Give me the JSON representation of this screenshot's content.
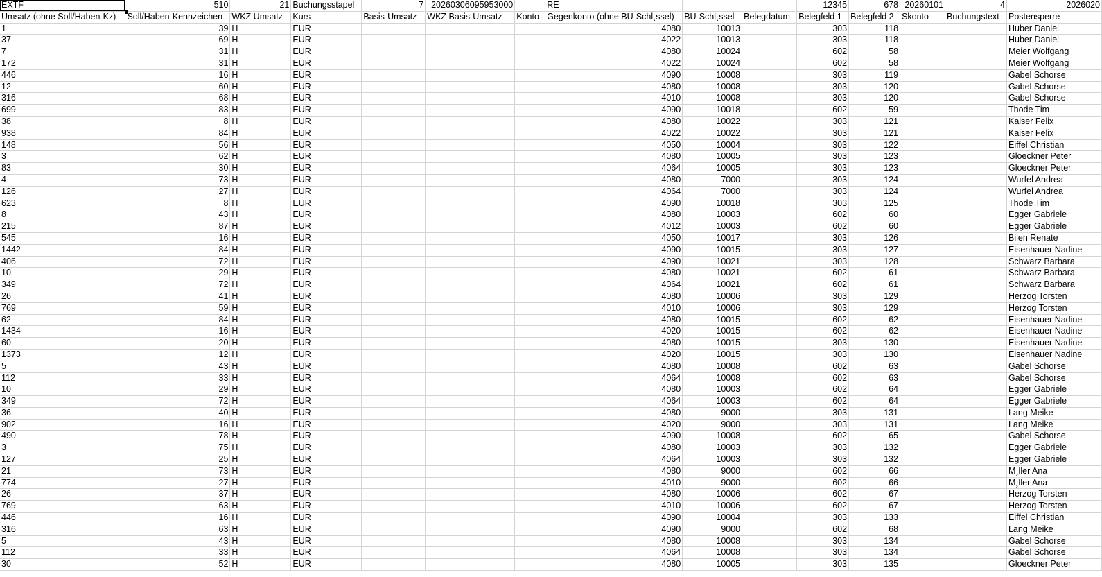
{
  "sheet": {
    "columns": [
      {
        "align": "txt"
      },
      {
        "align": "num"
      },
      {
        "align": "txt"
      },
      {
        "align": "txt"
      },
      {
        "align": "txt"
      },
      {
        "align": "txt"
      },
      {
        "align": "txt"
      },
      {
        "align": "num"
      },
      {
        "align": "num"
      },
      {
        "align": "txt"
      },
      {
        "align": "num"
      },
      {
        "align": "num"
      },
      {
        "align": "txt"
      },
      {
        "align": "txt"
      },
      {
        "align": "txt"
      }
    ],
    "meta_row": [
      "EXTF",
      "510",
      "21",
      "Buchungsstapel",
      "7",
      "20260306095953000",
      "",
      "RE",
      "",
      "",
      "12345",
      "678",
      "20260101",
      "4",
      "2026020"
    ],
    "meta_align": [
      "txt",
      "num",
      "num",
      "txt",
      "num",
      "num",
      "txt",
      "txt",
      "txt",
      "txt",
      "num",
      "num",
      "num",
      "num",
      "num"
    ],
    "header_row": [
      "Umsatz (ohne Soll/Haben-Kz)",
      "Soll/Haben-Kennzeichen",
      "WKZ Umsatz",
      "Kurs",
      "Basis-Umsatz",
      "WKZ Basis-Umsatz",
      "Konto",
      "Gegenkonto (ohne BU-Schl¸ssel)",
      "BU-Schl¸ssel",
      "Belegdatum",
      "Belegfeld 1",
      "Belegfeld 2",
      "Skonto",
      "Buchungstext",
      "Postensperre"
    ],
    "rows": [
      [
        "1",
        "39",
        "H",
        "EUR",
        "",
        "",
        "",
        "4080",
        "10013",
        "",
        "303",
        "118",
        "",
        "",
        "Huber Daniel"
      ],
      [
        "37",
        "69",
        "H",
        "EUR",
        "",
        "",
        "",
        "4022",
        "10013",
        "",
        "303",
        "118",
        "",
        "",
        "Huber Daniel"
      ],
      [
        "7",
        "31",
        "H",
        "EUR",
        "",
        "",
        "",
        "4080",
        "10024",
        "",
        "602",
        "58",
        "",
        "",
        "Meier Wolfgang"
      ],
      [
        "172",
        "31",
        "H",
        "EUR",
        "",
        "",
        "",
        "4022",
        "10024",
        "",
        "602",
        "58",
        "",
        "",
        "Meier Wolfgang"
      ],
      [
        "446",
        "16",
        "H",
        "EUR",
        "",
        "",
        "",
        "4090",
        "10008",
        "",
        "303",
        "119",
        "",
        "",
        "Gabel Schorse"
      ],
      [
        "12",
        "60",
        "H",
        "EUR",
        "",
        "",
        "",
        "4080",
        "10008",
        "",
        "303",
        "120",
        "",
        "",
        "Gabel Schorse"
      ],
      [
        "316",
        "68",
        "H",
        "EUR",
        "",
        "",
        "",
        "4010",
        "10008",
        "",
        "303",
        "120",
        "",
        "",
        "Gabel Schorse"
      ],
      [
        "699",
        "83",
        "H",
        "EUR",
        "",
        "",
        "",
        "4090",
        "10018",
        "",
        "602",
        "59",
        "",
        "",
        "Thode Tim"
      ],
      [
        "38",
        "8",
        "H",
        "EUR",
        "",
        "",
        "",
        "4080",
        "10022",
        "",
        "303",
        "121",
        "",
        "",
        "Kaiser Felix"
      ],
      [
        "938",
        "84",
        "H",
        "EUR",
        "",
        "",
        "",
        "4022",
        "10022",
        "",
        "303",
        "121",
        "",
        "",
        "Kaiser Felix"
      ],
      [
        "148",
        "56",
        "H",
        "EUR",
        "",
        "",
        "",
        "4050",
        "10004",
        "",
        "303",
        "122",
        "",
        "",
        "Eiffel Christian"
      ],
      [
        "3",
        "62",
        "H",
        "EUR",
        "",
        "",
        "",
        "4080",
        "10005",
        "",
        "303",
        "123",
        "",
        "",
        "Gloeckner Peter"
      ],
      [
        "83",
        "30",
        "H",
        "EUR",
        "",
        "",
        "",
        "4064",
        "10005",
        "",
        "303",
        "123",
        "",
        "",
        "Gloeckner Peter"
      ],
      [
        "4",
        "73",
        "H",
        "EUR",
        "",
        "",
        "",
        "4080",
        "7000",
        "",
        "303",
        "124",
        "",
        "",
        "Wurfel Andrea"
      ],
      [
        "126",
        "27",
        "H",
        "EUR",
        "",
        "",
        "",
        "4064",
        "7000",
        "",
        "303",
        "124",
        "",
        "",
        "Wurfel Andrea"
      ],
      [
        "623",
        "8",
        "H",
        "EUR",
        "",
        "",
        "",
        "4090",
        "10018",
        "",
        "303",
        "125",
        "",
        "",
        "Thode Tim"
      ],
      [
        "8",
        "43",
        "H",
        "EUR",
        "",
        "",
        "",
        "4080",
        "10003",
        "",
        "602",
        "60",
        "",
        "",
        "Egger Gabriele"
      ],
      [
        "215",
        "87",
        "H",
        "EUR",
        "",
        "",
        "",
        "4012",
        "10003",
        "",
        "602",
        "60",
        "",
        "",
        "Egger Gabriele"
      ],
      [
        "545",
        "16",
        "H",
        "EUR",
        "",
        "",
        "",
        "4050",
        "10017",
        "",
        "303",
        "126",
        "",
        "",
        "Bilen Renate"
      ],
      [
        "1442",
        "84",
        "H",
        "EUR",
        "",
        "",
        "",
        "4090",
        "10015",
        "",
        "303",
        "127",
        "",
        "",
        "Eisenhauer Nadine"
      ],
      [
        "406",
        "72",
        "H",
        "EUR",
        "",
        "",
        "",
        "4090",
        "10021",
        "",
        "303",
        "128",
        "",
        "",
        "Schwarz Barbara"
      ],
      [
        "10",
        "29",
        "H",
        "EUR",
        "",
        "",
        "",
        "4080",
        "10021",
        "",
        "602",
        "61",
        "",
        "",
        "Schwarz Barbara"
      ],
      [
        "349",
        "72",
        "H",
        "EUR",
        "",
        "",
        "",
        "4064",
        "10021",
        "",
        "602",
        "61",
        "",
        "",
        "Schwarz Barbara"
      ],
      [
        "26",
        "41",
        "H",
        "EUR",
        "",
        "",
        "",
        "4080",
        "10006",
        "",
        "303",
        "129",
        "",
        "",
        "Herzog Torsten"
      ],
      [
        "769",
        "59",
        "H",
        "EUR",
        "",
        "",
        "",
        "4010",
        "10006",
        "",
        "303",
        "129",
        "",
        "",
        "Herzog Torsten"
      ],
      [
        "62",
        "84",
        "H",
        "EUR",
        "",
        "",
        "",
        "4080",
        "10015",
        "",
        "602",
        "62",
        "",
        "",
        "Eisenhauer Nadine"
      ],
      [
        "1434",
        "16",
        "H",
        "EUR",
        "",
        "",
        "",
        "4020",
        "10015",
        "",
        "602",
        "62",
        "",
        "",
        "Eisenhauer Nadine"
      ],
      [
        "60",
        "20",
        "H",
        "EUR",
        "",
        "",
        "",
        "4080",
        "10015",
        "",
        "303",
        "130",
        "",
        "",
        "Eisenhauer Nadine"
      ],
      [
        "1373",
        "12",
        "H",
        "EUR",
        "",
        "",
        "",
        "4020",
        "10015",
        "",
        "303",
        "130",
        "",
        "",
        "Eisenhauer Nadine"
      ],
      [
        "5",
        "43",
        "H",
        "EUR",
        "",
        "",
        "",
        "4080",
        "10008",
        "",
        "602",
        "63",
        "",
        "",
        "Gabel Schorse"
      ],
      [
        "112",
        "33",
        "H",
        "EUR",
        "",
        "",
        "",
        "4064",
        "10008",
        "",
        "602",
        "63",
        "",
        "",
        "Gabel Schorse"
      ],
      [
        "10",
        "29",
        "H",
        "EUR",
        "",
        "",
        "",
        "4080",
        "10003",
        "",
        "602",
        "64",
        "",
        "",
        "Egger Gabriele"
      ],
      [
        "349",
        "72",
        "H",
        "EUR",
        "",
        "",
        "",
        "4064",
        "10003",
        "",
        "602",
        "64",
        "",
        "",
        "Egger Gabriele"
      ],
      [
        "36",
        "40",
        "H",
        "EUR",
        "",
        "",
        "",
        "4080",
        "9000",
        "",
        "303",
        "131",
        "",
        "",
        "Lang Meike"
      ],
      [
        "902",
        "16",
        "H",
        "EUR",
        "",
        "",
        "",
        "4020",
        "9000",
        "",
        "303",
        "131",
        "",
        "",
        "Lang Meike"
      ],
      [
        "490",
        "78",
        "H",
        "EUR",
        "",
        "",
        "",
        "4090",
        "10008",
        "",
        "602",
        "65",
        "",
        "",
        "Gabel Schorse"
      ],
      [
        "3",
        "75",
        "H",
        "EUR",
        "",
        "",
        "",
        "4080",
        "10003",
        "",
        "303",
        "132",
        "",
        "",
        "Egger Gabriele"
      ],
      [
        "127",
        "25",
        "H",
        "EUR",
        "",
        "",
        "",
        "4064",
        "10003",
        "",
        "303",
        "132",
        "",
        "",
        "Egger Gabriele"
      ],
      [
        "21",
        "73",
        "H",
        "EUR",
        "",
        "",
        "",
        "4080",
        "9000",
        "",
        "602",
        "66",
        "",
        "",
        "M¸ller Ana"
      ],
      [
        "774",
        "27",
        "H",
        "EUR",
        "",
        "",
        "",
        "4010",
        "9000",
        "",
        "602",
        "66",
        "",
        "",
        "M¸ller Ana"
      ],
      [
        "26",
        "37",
        "H",
        "EUR",
        "",
        "",
        "",
        "4080",
        "10006",
        "",
        "602",
        "67",
        "",
        "",
        "Herzog Torsten"
      ],
      [
        "769",
        "63",
        "H",
        "EUR",
        "",
        "",
        "",
        "4010",
        "10006",
        "",
        "602",
        "67",
        "",
        "",
        "Herzog Torsten"
      ],
      [
        "446",
        "16",
        "H",
        "EUR",
        "",
        "",
        "",
        "4090",
        "10004",
        "",
        "303",
        "133",
        "",
        "",
        "Eiffel Christian"
      ],
      [
        "316",
        "63",
        "H",
        "EUR",
        "",
        "",
        "",
        "4090",
        "9000",
        "",
        "602",
        "68",
        "",
        "",
        "Lang Meike"
      ],
      [
        "5",
        "43",
        "H",
        "EUR",
        "",
        "",
        "",
        "4080",
        "10008",
        "",
        "303",
        "134",
        "",
        "",
        "Gabel Schorse"
      ],
      [
        "112",
        "33",
        "H",
        "EUR",
        "",
        "",
        "",
        "4064",
        "10008",
        "",
        "303",
        "134",
        "",
        "",
        "Gabel Schorse"
      ],
      [
        "30",
        "52",
        "H",
        "EUR",
        "",
        "",
        "",
        "4080",
        "10005",
        "",
        "303",
        "135",
        "",
        "",
        "Gloeckner Peter"
      ]
    ]
  }
}
